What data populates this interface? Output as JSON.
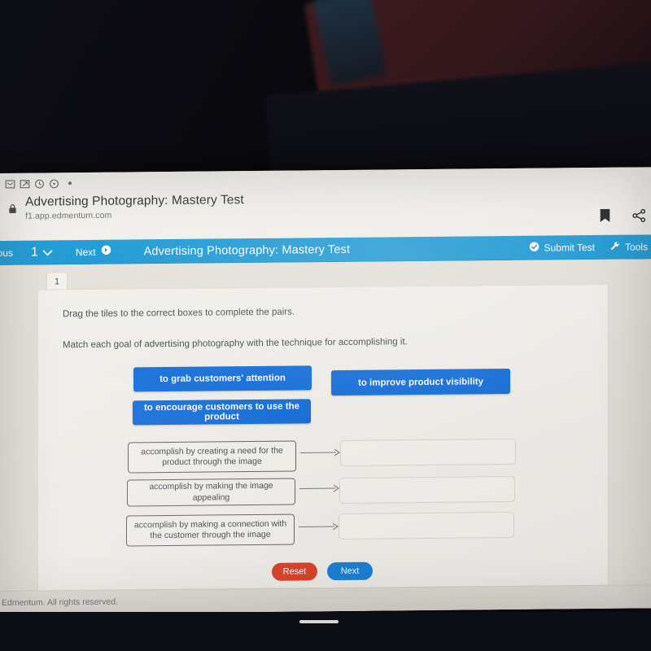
{
  "browser": {
    "tab_icons": [
      "tab-restore-icon",
      "tab-sync-icon",
      "history-icon",
      "recent-icon"
    ],
    "page_title": "Advertising Photography: Mastery Test",
    "page_url": "f1.app.edmentum.com",
    "lock_icon": "lock-icon",
    "bookmark_icon": "bookmark-icon",
    "share_icon": "share-icon"
  },
  "appbar": {
    "previous_label": "vious",
    "question_number": "1",
    "chevron_icon": "chevron-down-icon",
    "next_label": "Next",
    "next_icon": "circle-arrow-right-icon",
    "title": "Advertising Photography: Mastery Test",
    "submit_label": "Submit Test",
    "submit_icon": "check-circle-icon",
    "tools_label": "Tools",
    "tools_icon": "wrench-icon",
    "bar_color": "#1b9ad6"
  },
  "question": {
    "number_tab": "1",
    "instruction_1": "Drag the tiles to the correct boxes to complete the pairs.",
    "instruction_2": "Match each goal of advertising photography with the technique for accomplishing it.",
    "tile_color": "#1570dd",
    "tiles": [
      {
        "label": "to grab customers' attention"
      },
      {
        "label": "to improve product visibility"
      },
      {
        "label": "to encourage customers to use the product"
      }
    ],
    "pairs": [
      {
        "prompt": "accomplish by creating a need for the product through the image",
        "answer": ""
      },
      {
        "prompt": "accomplish by making the image appealing",
        "answer": ""
      },
      {
        "prompt": "accomplish by making a connection with the customer through the image",
        "answer": ""
      }
    ],
    "connector_icon": "arrow-right-icon"
  },
  "actions": {
    "reset_label": "Reset",
    "reset_color": "#e0412a",
    "next_label": "Next",
    "next_color": "#1a82d8"
  },
  "footer": {
    "copyright": "Edmentum. All rights reserved."
  }
}
